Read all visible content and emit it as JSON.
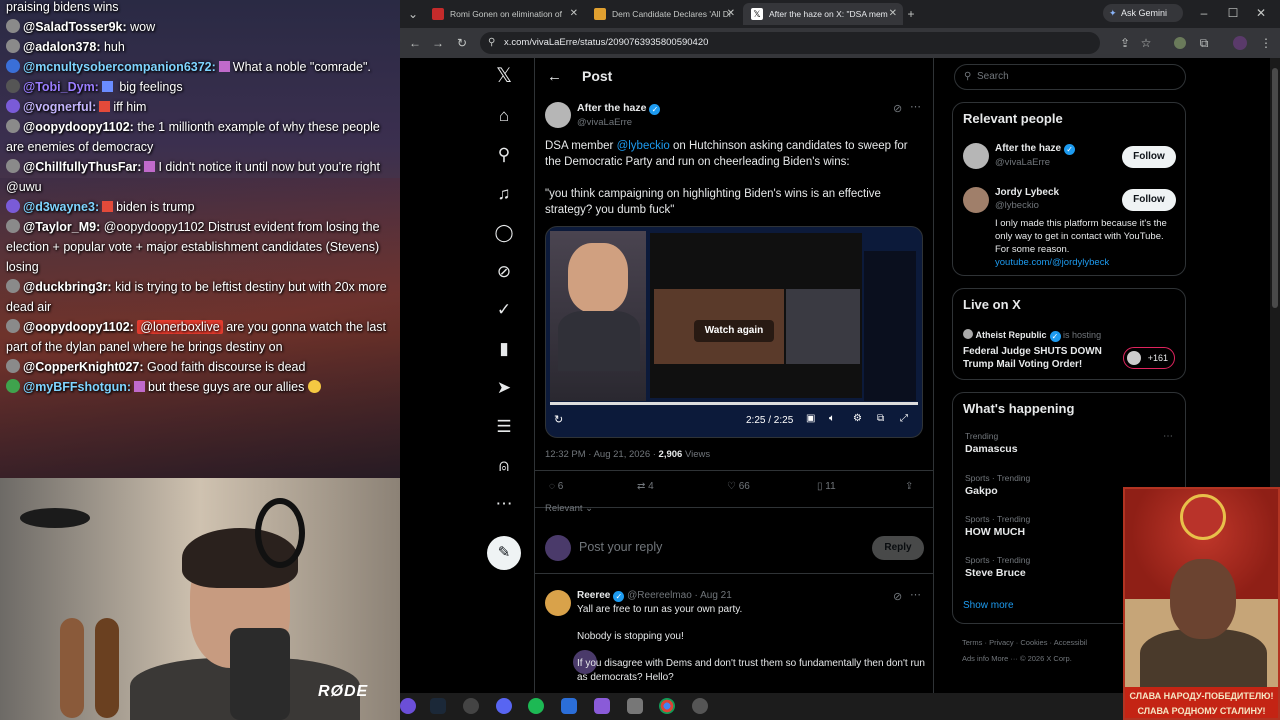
{
  "chat": {
    "messages": [
      {
        "user": "",
        "text": "praising bidens wins"
      },
      {
        "user": "@SaladTosser9k:",
        "text": "wow"
      },
      {
        "user": "@adalon378:",
        "text": "huh"
      },
      {
        "user": "@mcnultysobercompanion6372:",
        "text": "What a noble \"comrade\"."
      },
      {
        "user": "@Tobi_Dym:",
        "text": "big feelings"
      },
      {
        "user": "@vognerful:",
        "text": "iff him"
      },
      {
        "user": "@oopydoopy1102:",
        "text": "the 1 millionth example of why these people are enemies of democracy"
      },
      {
        "user": "@ChillfullyThusFar:",
        "text": "I didn't notice it until now but you're right @uwu"
      },
      {
        "user": "@d3wayne3:",
        "text": "biden is trump"
      },
      {
        "user": "@Taylor_M9:",
        "text": "@oopydoopy1102 Distrust evident from losing the election + popular vote + major establishment candidates (Stevens) losing"
      },
      {
        "user": "@duckbring3r:",
        "text": "kid is trying to be leftist destiny but with 20x more dead air"
      },
      {
        "user": "@oopydoopy1102:",
        "mention": "@lonerboxlive",
        "text": "are you gonna watch the last part of the dylan panel where he brings destiny on"
      },
      {
        "user": "@CopperKnight027:",
        "text": "Good faith discourse is dead"
      },
      {
        "user": "@myBFFshotgun:",
        "text": "but these guys are our allies"
      }
    ],
    "colors": {
      "SaladTosser9k": "#ffffff",
      "adalon378": "#ffffff",
      "mcnulty": "#7fd4ff",
      "tobi": "#9a7dff",
      "vognerful": "#a78bfa",
      "oopydoopy": "#ffffff",
      "chillfully": "#ffffff",
      "d3wayne3": "#7fd4ff",
      "taylor": "#ffffff",
      "duck": "#ffffff",
      "copper": "#ffffff",
      "mybff": "#7fd4ff"
    }
  },
  "webcam": {
    "mic_brand": "RØDE"
  },
  "browser": {
    "tabs": [
      {
        "label": "Romi Gonen on elimination of",
        "favicon_color": "#c42b2b"
      },
      {
        "label": "Dem Candidate Declares 'All Di",
        "favicon_color": "#e0a030"
      },
      {
        "label": "After the haze on X: \"DSA mem",
        "favicon_color": "#ffffff"
      }
    ],
    "new_tab": "+",
    "gemini": "Ask Gemini",
    "url": "x.com/vivaLaErre/status/2090763935800590420"
  },
  "x": {
    "header_title": "Post",
    "post": {
      "author": "After the haze",
      "handle": "@vivaLaErre",
      "text_pre": "DSA member ",
      "mention": "@lybeckio",
      "text_post": " on Hutchinson asking candidates to sweep for the Democratic Party and run on cheerleading Biden's wins:",
      "quote": "\"you think campaigning on highlighting Biden's wins is an effective strategy? you dumb fuck\"",
      "video_overlay": "Watch again",
      "video_time": "2:25 / 2:25",
      "timestamp": "12:32 PM · Aug 21, 2026 · ",
      "views_count": "2,906",
      "views_label": " Views",
      "replies": "6",
      "reposts": "4",
      "likes": "66",
      "bookmarks": "11",
      "sort": "Relevant",
      "reply_placeholder": "Post your reply",
      "reply_button": "Reply"
    },
    "reply": {
      "author": "Reeree",
      "handle": "@Reereelmao · Aug 21",
      "lines": [
        "Yall are free to run as your own party.",
        "Nobody is stopping you!",
        "If you disagree with Dems and don't trust them so fundamentally then don't run as democrats? Hello?"
      ]
    },
    "search_placeholder": "Search",
    "relevant_people": {
      "title": "Relevant people",
      "people": [
        {
          "name": "After the haze",
          "handle": "@vivaLaErre",
          "button": "Follow"
        },
        {
          "name": "Jordy Lybeck",
          "handle": "@lybeckio",
          "button": "Follow",
          "bio": "I only made this platform because it's the only way to get in contact with YouTube. For some reason.",
          "link": "youtube.com/@jordylybeck"
        }
      ]
    },
    "live": {
      "title": "Live on X",
      "host": "Atheist Republic",
      "hosting": "is hosting",
      "headline": "Federal Judge SHUTS DOWN Trump Mail Voting Order!",
      "listeners": "+161"
    },
    "happening": {
      "title": "What's happening",
      "trends": [
        {
          "category": "Trending",
          "name": "Damascus"
        },
        {
          "category": "Sports · Trending",
          "name": "Gakpo"
        },
        {
          "category": "Sports · Trending",
          "name": "HOW MUCH"
        },
        {
          "category": "Sports · Trending",
          "name": "Steve Bruce"
        }
      ],
      "show_more": "Show more"
    },
    "footer": {
      "links": [
        "Terms",
        "Privacy",
        "Cookies",
        "Accessibil"
      ],
      "links2": [
        "Ads info",
        "More ···",
        "© 2026 X Corp."
      ]
    }
  },
  "poster": {
    "caption1": "СЛАВА НАРОДУ-ПОБЕДИТЕЛЮ!",
    "caption2": "СЛАВА РОДНОМУ СТАЛИНУ!"
  },
  "icons": [
    "x-logo",
    "home-icon",
    "search-icon",
    "bell-icon",
    "message-icon",
    "grok-icon",
    "verified-orgs-icon",
    "bookmark-icon",
    "rocket-icon",
    "lists-icon",
    "profile-icon",
    "more-icon",
    "compose-icon"
  ]
}
